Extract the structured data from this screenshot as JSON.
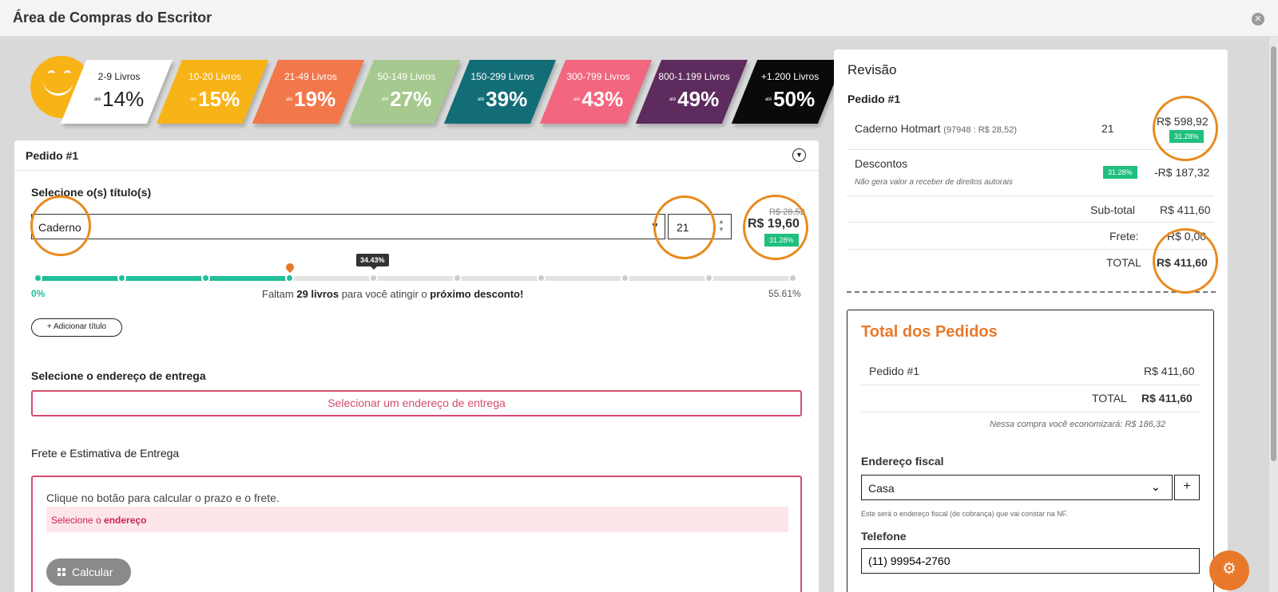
{
  "window": {
    "title": "Área de Compras do Escritor",
    "close_glyph": "✕"
  },
  "tiers": [
    {
      "label": "2-9 Livros",
      "ate": "até",
      "pct": "14%",
      "color": "#ffffff"
    },
    {
      "label": "10-20 Livros",
      "ate": "até",
      "pct": "15%",
      "color": "#f8b316"
    },
    {
      "label": "21-49 Livros",
      "ate": "até",
      "pct": "19%",
      "color": "#f2784b"
    },
    {
      "label": "50-149 Livros",
      "ate": "até",
      "pct": "27%",
      "color": "#a6c98f"
    },
    {
      "label": "150-299 Livros",
      "ate": "até",
      "pct": "39%",
      "color": "#136d77"
    },
    {
      "label": "300-799 Livros",
      "ate": "até",
      "pct": "43%",
      "color": "#f2667f"
    },
    {
      "label": "800-1.199 Livros",
      "ate": "até",
      "pct": "49%",
      "color": "#5e2b5e"
    },
    {
      "label": "+1.200 Livros",
      "ate": "até",
      "pct": "50%",
      "color": "#0a0a0a"
    }
  ],
  "order": {
    "header": "Pedido #1",
    "select_title_label": "Selecione o(s) título(s)",
    "title_value": "Caderno",
    "quantity": "21",
    "price_old": "R$ 28,52",
    "price_new": "R$ 19,60",
    "price_badge": "31.28%",
    "progress": {
      "tooltip": "34.43%",
      "start_label": "0%",
      "end_label": "55.61%",
      "filled_steps": 4,
      "total_steps": 10,
      "msg_pre": "Faltam ",
      "msg_count": "29 livros",
      "msg_mid": " para você atingir o ",
      "msg_target": "próximo desconto!"
    },
    "add_title_button": "Adicionar título",
    "add_glyph": "+",
    "address_label": "Selecione o endereço de entrega",
    "address_button": "Selecionar um endereço de entrega",
    "freight_label": "Frete e Estimativa de Entrega",
    "freight_msg": "Clique no botão para calcular o prazo e o frete.",
    "freight_warn_pre": "Selecione o ",
    "freight_warn_bold": "endereço",
    "calc_button": "Calcular"
  },
  "review": {
    "title": "Revisão",
    "order_label": "Pedido #1",
    "item_name": "Caderno Hotmart",
    "item_detail": "(97948 : R$ 28,52)",
    "item_qty": "21",
    "item_price": "R$ 598,92",
    "item_badge": "31.28%",
    "discount_label": "Descontos",
    "discount_note": "Não gera valor a receber de direitos autorais",
    "discount_badge": "31.28%",
    "discount_value": "-R$ 187,32",
    "subtotal_label": "Sub-total",
    "subtotal_value": "R$ 411,60",
    "freight_label": "Frete:",
    "freight_value": "R$ 0,00",
    "total_label": "TOTAL",
    "total_value": "R$ 411,60"
  },
  "totals": {
    "title": "Total dos Pedidos",
    "order_label": "Pedido #1",
    "order_value": "R$ 411,60",
    "total_label": "TOTAL",
    "total_value": "R$ 411,60",
    "savings": "Nessa compra você economizará: R$ 186,32",
    "fiscal_label": "Endereço fiscal",
    "fiscal_value": "Casa",
    "fiscal_add": "+",
    "fiscal_note": "Este será o endereço fiscal (de cobrança) que vai constar na NF.",
    "phone_label": "Telefone",
    "phone_value": "(11) 99954-2760"
  },
  "icons": {
    "collapse": "chevron-down-circle-icon",
    "gear": "gear-icon",
    "grid": "grid-icon",
    "pin": "map-pin-icon"
  },
  "colors": {
    "accent": "#e8792a",
    "success": "#1fbf9a",
    "danger": "#d44d6f"
  }
}
